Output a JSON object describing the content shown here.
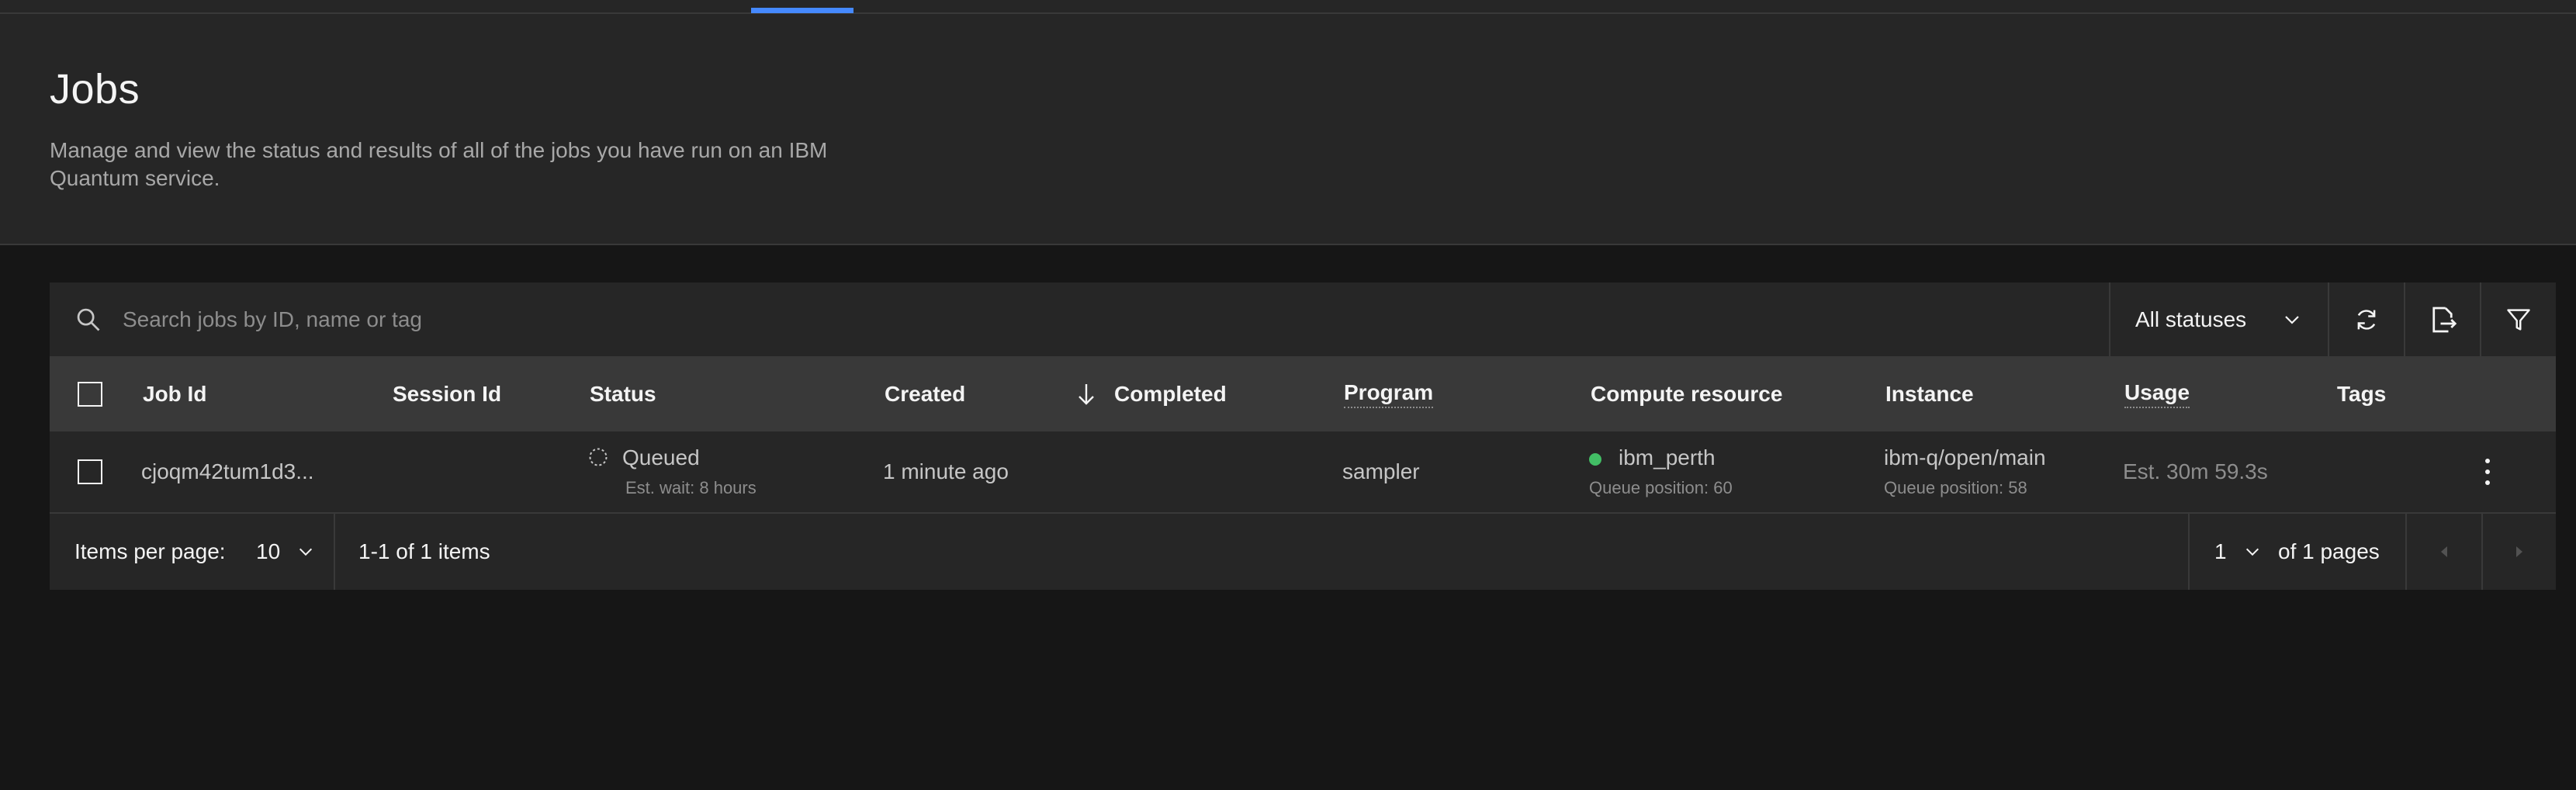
{
  "page": {
    "title": "Jobs",
    "description": "Manage and view the status and results of all of the jobs you have run on an IBM Quantum service."
  },
  "toolbar": {
    "search_placeholder": "Search jobs by ID, name or tag",
    "status_filter": "All statuses",
    "icons": [
      "search-icon",
      "chevron-down-icon",
      "refresh-icon",
      "export-icon",
      "filter-icon"
    ]
  },
  "table": {
    "columns": [
      "Job Id",
      "Session Id",
      "Status",
      "Created",
      "Completed",
      "Program",
      "Compute resource",
      "Instance",
      "Usage",
      "Tags"
    ],
    "sort_column": "Created",
    "rows": [
      {
        "job_id": "cjoqm42tum1d3...",
        "session_id": "",
        "status": "Queued",
        "status_detail": "Est. wait: 8 hours",
        "created": "1 minute ago",
        "completed": "",
        "program": "sampler",
        "compute_resource": "ibm_perth",
        "compute_detail": "Queue position: 60",
        "instance": "ibm-q/open/main",
        "instance_detail": "Queue position: 58",
        "usage": "Est. 30m 59.3s",
        "tags": ""
      }
    ]
  },
  "pagination": {
    "items_per_page_label": "Items per page:",
    "items_per_page": "10",
    "range": "1-1 of 1 items",
    "page": "1",
    "of_pages": "of 1 pages"
  },
  "colors": {
    "background": "#161616",
    "panel": "#262626",
    "header_row": "#393939",
    "accent": "#4589ff",
    "online_dot": "#42be65"
  }
}
